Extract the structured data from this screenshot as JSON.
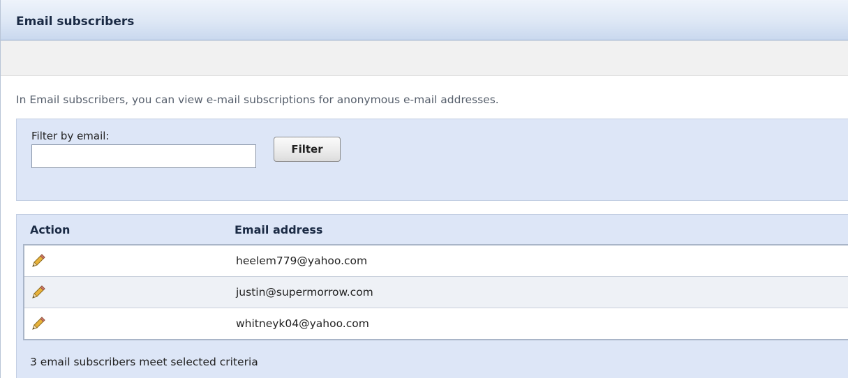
{
  "header": {
    "title": "Email subscribers"
  },
  "description": "In Email subscribers, you can view e-mail subscriptions for anonymous e-mail addresses.",
  "filter": {
    "label": "Filter by email:",
    "input_value": "",
    "button_label": "Filter"
  },
  "grid": {
    "columns": [
      "Action",
      "Email address"
    ],
    "rows": [
      {
        "action_icon": "pencil-icon",
        "email": "heelem779@yahoo.com"
      },
      {
        "action_icon": "pencil-icon",
        "email": "justin@supermorrow.com"
      },
      {
        "action_icon": "pencil-icon",
        "email": "whitneyk04@yahoo.com"
      }
    ],
    "footer": "3 email subscribers meet selected criteria"
  },
  "colors": {
    "panel_background": "#dde6f7",
    "title_text": "#1a2a44",
    "row_alternate": "#eef1f6"
  }
}
